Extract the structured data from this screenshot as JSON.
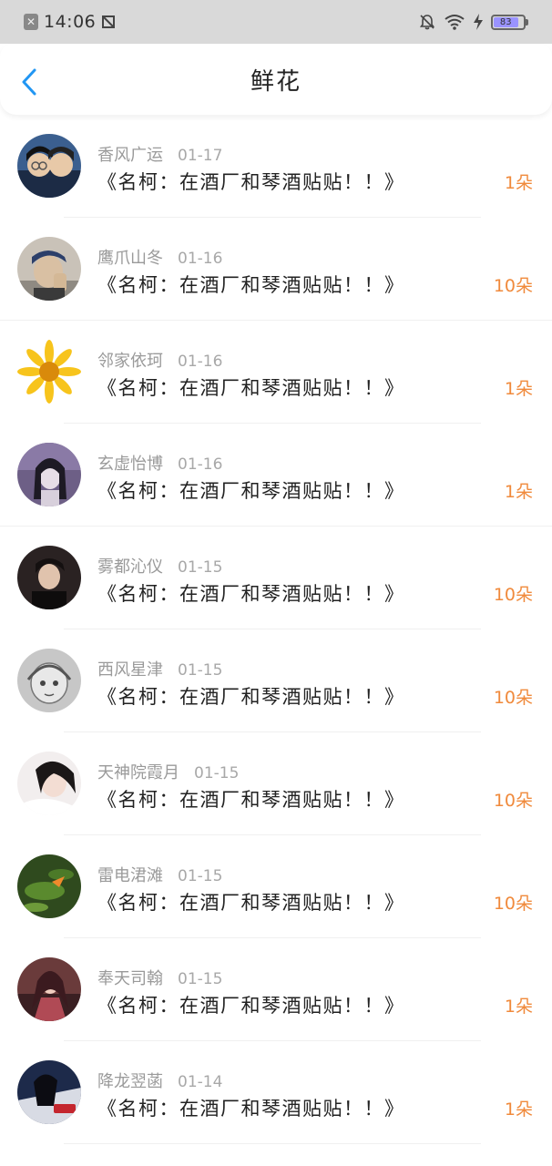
{
  "status_bar": {
    "time": "14:06",
    "battery": "83"
  },
  "nav": {
    "title": "鲜花"
  },
  "items": [
    {
      "name": "香风广运",
      "date": "01-17",
      "work": "《名柯：在酒厂和琴酒贴贴！！》",
      "amount": "1朵"
    },
    {
      "name": "鹰爪山冬",
      "date": "01-16",
      "work": "《名柯：在酒厂和琴酒贴贴！！》",
      "amount": "10朵"
    },
    {
      "name": "邻家依珂",
      "date": "01-16",
      "work": "《名柯：在酒厂和琴酒贴贴！！》",
      "amount": "1朵"
    },
    {
      "name": "玄虚怡博",
      "date": "01-16",
      "work": "《名柯：在酒厂和琴酒贴贴！！》",
      "amount": "1朵"
    },
    {
      "name": "雾都沁仪",
      "date": "01-15",
      "work": "《名柯：在酒厂和琴酒贴贴！！》",
      "amount": "10朵"
    },
    {
      "name": "西风星津",
      "date": "01-15",
      "work": "《名柯：在酒厂和琴酒贴贴！！》",
      "amount": "10朵"
    },
    {
      "name": "天神院霞月",
      "date": "01-15",
      "work": "《名柯：在酒厂和琴酒贴贴！！》",
      "amount": "10朵"
    },
    {
      "name": "雷电涒滩",
      "date": "01-15",
      "work": "《名柯：在酒厂和琴酒贴贴！！》",
      "amount": "10朵"
    },
    {
      "name": "奉天司翰",
      "date": "01-15",
      "work": "《名柯：在酒厂和琴酒贴贴！！》",
      "amount": "1朵"
    },
    {
      "name": "降龙翌菡",
      "date": "01-14",
      "work": "《名柯：在酒厂和琴酒贴贴！！》",
      "amount": "1朵"
    }
  ],
  "colors": {
    "accent": "#f08a3c",
    "back_arrow": "#2196f3",
    "status_bar_bg": "#d9d9d9"
  },
  "icons": [
    "notification-off-icon",
    "wifi-icon",
    "charging-icon",
    "battery-icon",
    "back-arrow-icon"
  ]
}
